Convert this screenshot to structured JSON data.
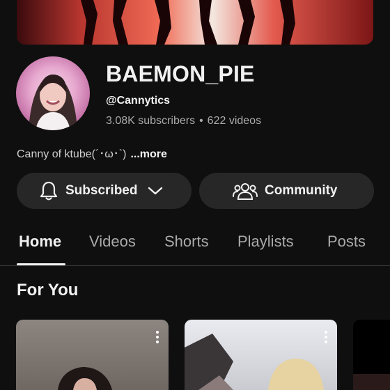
{
  "channel": {
    "name": "BAEMON_PIE",
    "handle": "@Cannytics",
    "subscribers": "3.08K subscribers",
    "separator": "•",
    "videos": "622 videos",
    "description": "Canny of ktube(´･ω･`)",
    "more_label": "...more"
  },
  "actions": {
    "subscribe_label": "Subscribed",
    "community_label": "Community"
  },
  "tabs": [
    {
      "label": "Home",
      "active": true
    },
    {
      "label": "Videos"
    },
    {
      "label": "Shorts"
    },
    {
      "label": "Playlists"
    },
    {
      "label": "Posts"
    }
  ],
  "section": {
    "title": "For You"
  },
  "icons": {
    "bell": "bell-icon",
    "chevron": "chevron-down-icon",
    "community": "community-icon",
    "kebab": "more-vert-icon"
  },
  "colors": {
    "background": "#0f0f0f",
    "button_bg": "#272727",
    "text_primary": "#f1f1f1",
    "text_secondary": "#aaaaaa"
  }
}
